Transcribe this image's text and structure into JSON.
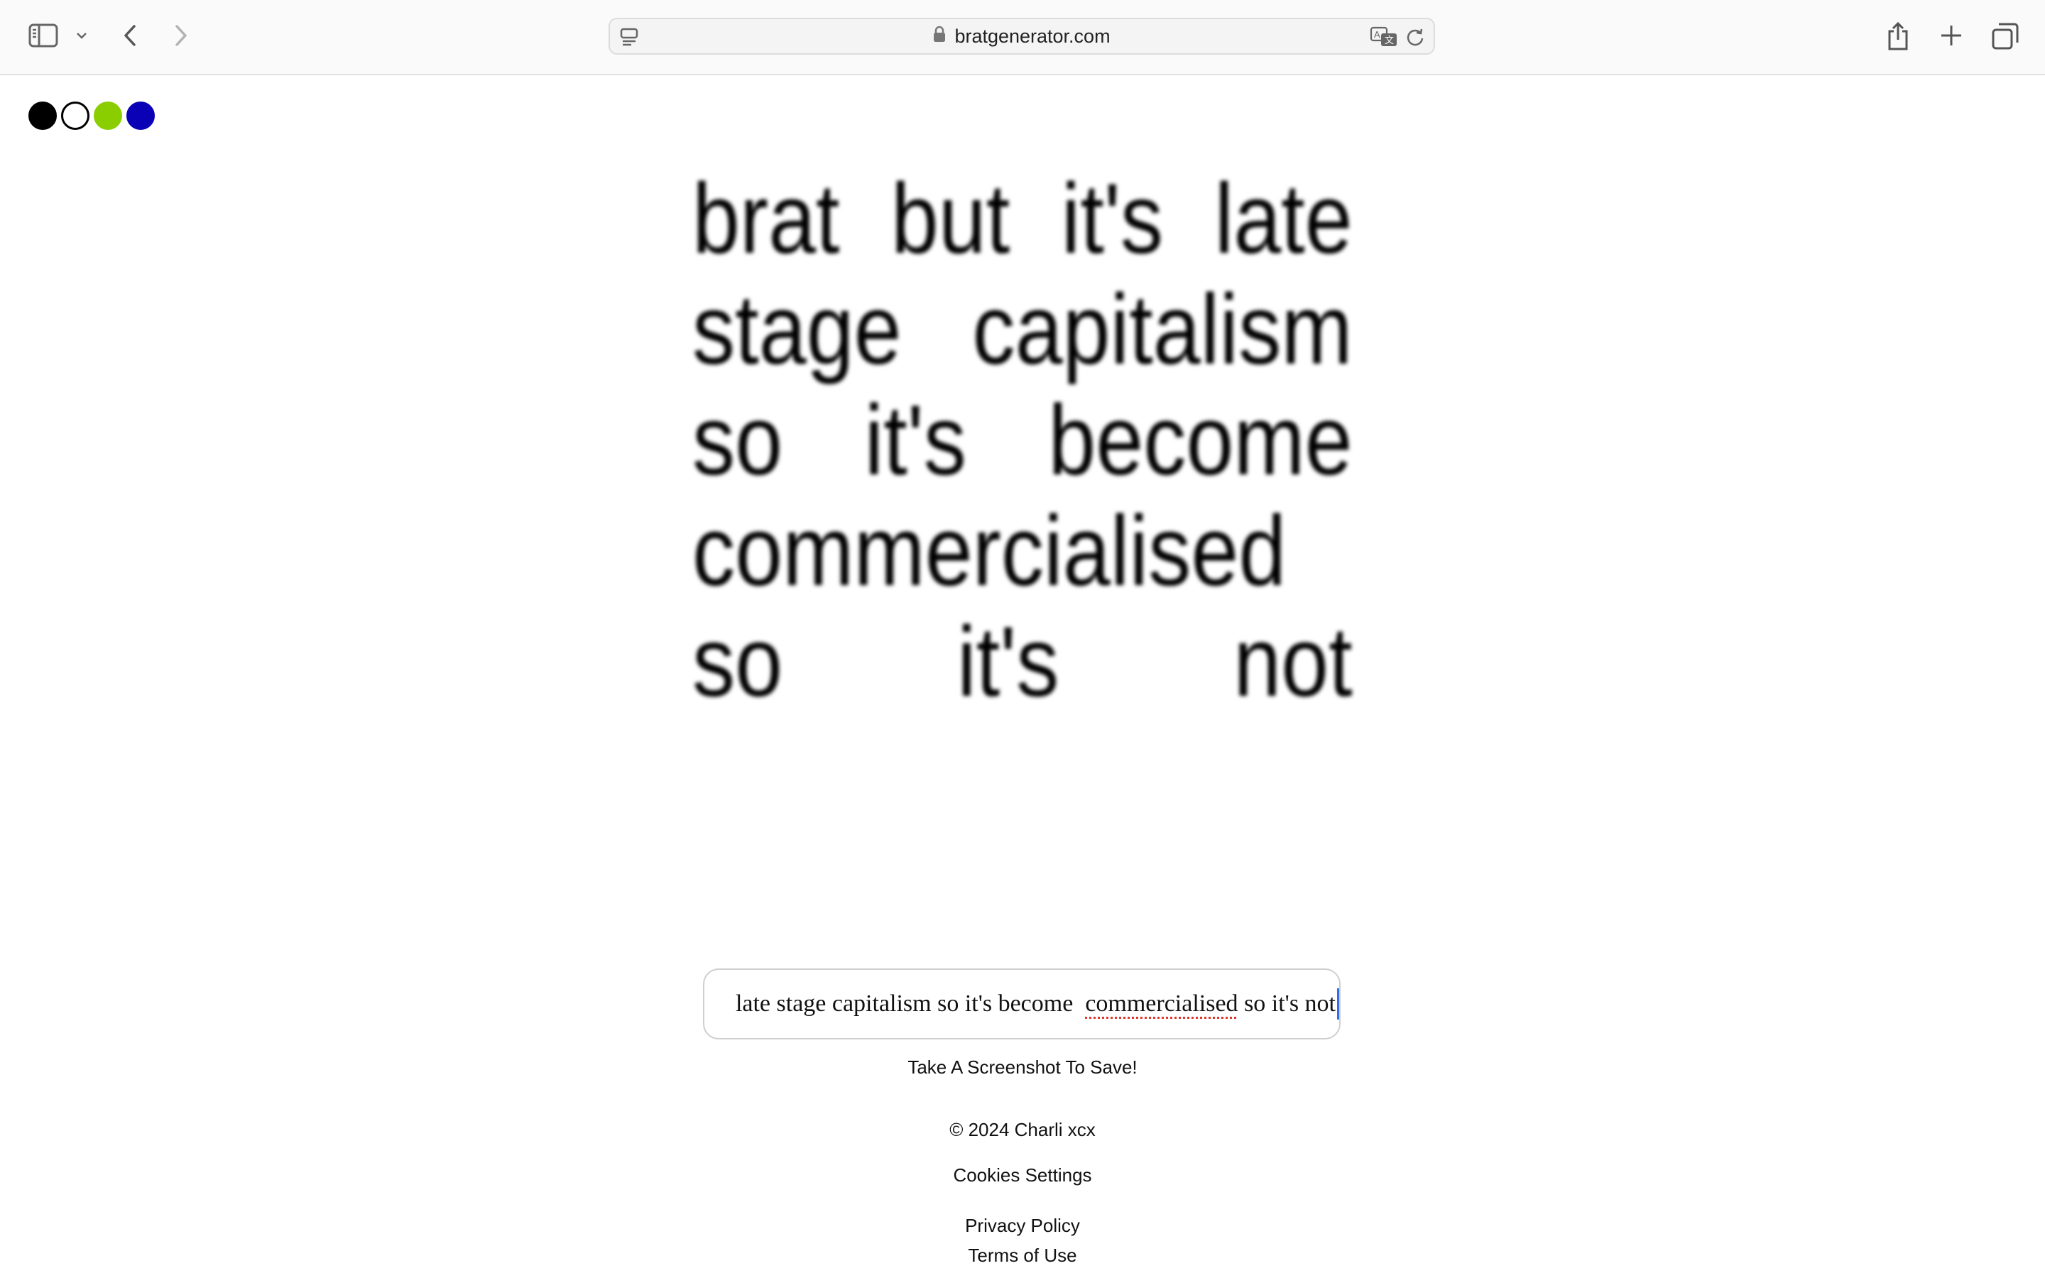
{
  "browser": {
    "url": "bratgenerator.com"
  },
  "swatches": [
    {
      "name": "black",
      "fill": "#000000",
      "border": "#000000"
    },
    {
      "name": "white",
      "fill": "#ffffff",
      "border": "#000000"
    },
    {
      "name": "green",
      "fill": "#8ace00",
      "border": "#8ace00"
    },
    {
      "name": "blue",
      "fill": "#0a00b6",
      "border": "#0a00b6"
    }
  ],
  "brat": {
    "lines": [
      [
        "brat",
        "but",
        "it's",
        "late"
      ],
      [
        "stage",
        "capitalism"
      ],
      [
        "so",
        "it's",
        "become"
      ],
      [
        "commercialised"
      ],
      [
        "so",
        "it's",
        "not"
      ]
    ]
  },
  "input": {
    "text_before": "late stage capitalism so it's become  ",
    "text_misspelled": "commercialised",
    "text_after": " so it's not"
  },
  "footer": {
    "hint": "Take A Screenshot To Save!",
    "copyright": "© 2024 Charli xcx",
    "cookies": "Cookies Settings",
    "privacy": "Privacy Policy",
    "terms": "Terms of Use"
  }
}
